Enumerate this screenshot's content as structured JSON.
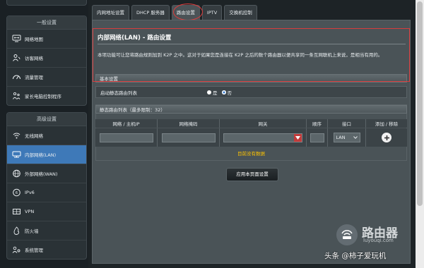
{
  "sidebar": {
    "top_partial_label": "网络地图",
    "general_header": "一般设置",
    "general_items": [
      {
        "label": "网络地图",
        "icon": "network-map-icon"
      },
      {
        "label": "访客网络",
        "icon": "guest-network-icon"
      },
      {
        "label": "流量管理",
        "icon": "traffic-manager-icon"
      },
      {
        "label": "家长电脑控制程序",
        "icon": "parental-control-icon"
      }
    ],
    "advanced_header": "高级设置",
    "advanced_items": [
      {
        "label": "无线网络",
        "icon": "wireless-icon"
      },
      {
        "label": "内部网络(LAN)",
        "icon": "lan-icon",
        "active": true
      },
      {
        "label": "外部网络(WAN)",
        "icon": "wan-globe-icon"
      },
      {
        "label": "IPv6",
        "icon": "ipv6-icon"
      },
      {
        "label": "VPN",
        "icon": "vpn-icon"
      },
      {
        "label": "防火墙",
        "icon": "firewall-icon"
      },
      {
        "label": "系统管理",
        "icon": "administration-icon"
      }
    ]
  },
  "tabs": [
    "内网地址设置",
    "DHCP 服务器",
    "路由设置",
    "IPTV",
    "交换机控制"
  ],
  "active_tab": "路由设置",
  "panel": {
    "title": "内部网络(LAN) - 路由设置",
    "description": "本项功能可让您将路由规则加到 K2P 之中。这对于如果您是连接在 K2P 之后的数个路由器以便共享同一条互网联机上来说，是相当有用的。",
    "basic_section": "基本设置",
    "enable_label": "启动静态路由列表",
    "radio_yes": "是",
    "radio_no": "否",
    "selected_radio": "否",
    "static_list_title": "静态路由列表（最多限制：32）",
    "columns": [
      "网络 / 主机IP",
      "网络掩码",
      "网关",
      "顺序",
      "接口",
      "添加 / 移除"
    ],
    "interface_value": "LAN",
    "empty_text": "目前没有数据",
    "apply_button": "应用本页面设置"
  },
  "watermark": {
    "site_name": "路由器",
    "site_url": "luyouqi.com",
    "credit": "头条 @柿子爱玩机"
  },
  "colors": {
    "accent_blue": "#3e79b8",
    "annotation_red": "#d83c3c",
    "empty_text_yellow": "#ffc400"
  }
}
